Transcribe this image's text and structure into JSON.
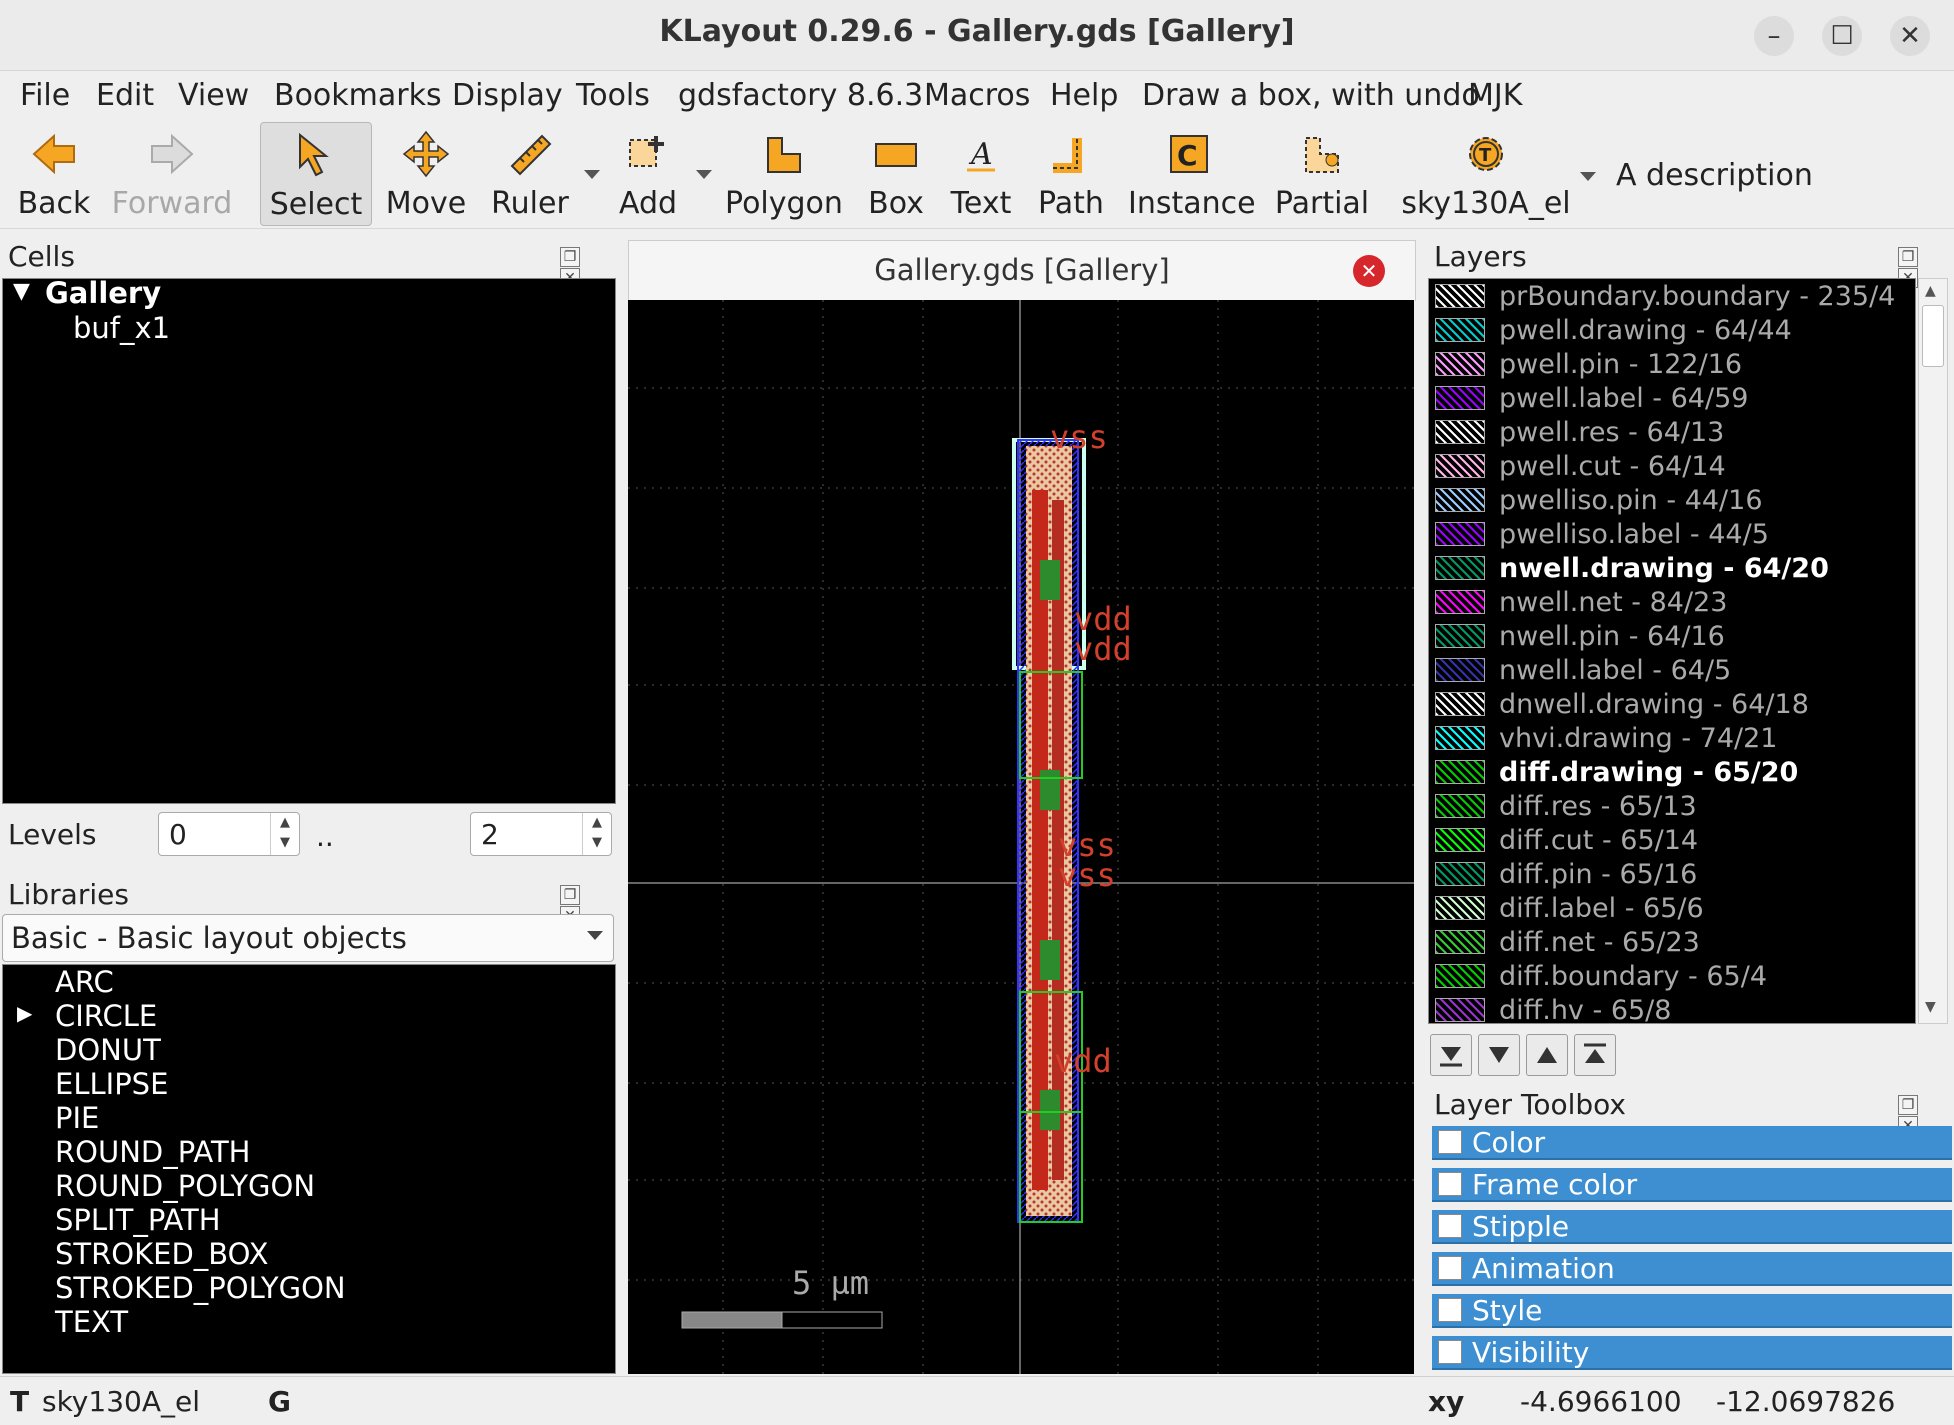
{
  "window": {
    "title": "KLayout 0.29.6 - Gallery.gds [Gallery]"
  },
  "menu": [
    "File",
    "Edit",
    "View",
    "Bookmarks",
    "Display",
    "Tools",
    "gdsfactory 8.6.3",
    "Macros",
    "Help",
    "Draw a box, with undo",
    "MJK"
  ],
  "toolbar": {
    "back": "Back",
    "forward": "Forward",
    "select": "Select",
    "move": "Move",
    "ruler": "Ruler",
    "add": "Add",
    "polygon": "Polygon",
    "box": "Box",
    "text": "Text",
    "path": "Path",
    "instance": "Instance",
    "partial": "Partial",
    "tech": "sky130A_el",
    "description": "A description"
  },
  "cells": {
    "title": "Cells",
    "items": [
      "Gallery",
      "buf_x1"
    ],
    "levels_label": "Levels",
    "level_from": "0",
    "level_sep": "..",
    "level_to": "2"
  },
  "libraries": {
    "title": "Libraries",
    "selected": "Basic - Basic layout objects",
    "items": [
      "ARC",
      "CIRCLE",
      "DONUT",
      "ELLIPSE",
      "PIE",
      "ROUND_PATH",
      "ROUND_POLYGON",
      "SPLIT_PATH",
      "STROKED_BOX",
      "STROKED_POLYGON",
      "TEXT"
    ]
  },
  "canvas": {
    "tab_title": "Gallery.gds [Gallery]",
    "scale_label": "5 µm",
    "labels": [
      "vss",
      "vdd",
      "vdd",
      "vss",
      "vss",
      "vdd"
    ]
  },
  "layers": {
    "title": "Layers",
    "items": [
      {
        "name": "prBoundary.boundary - 235/4",
        "color": "#ffffff",
        "bold": false
      },
      {
        "name": "pwell.drawing - 64/44",
        "color": "#00cccc",
        "bold": false
      },
      {
        "name": "pwell.pin - 122/16",
        "color": "#ff99ff",
        "bold": false
      },
      {
        "name": "pwell.label - 64/59",
        "color": "#9900ff",
        "bold": false
      },
      {
        "name": "pwell.res - 64/13",
        "color": "#ffffff",
        "bold": false
      },
      {
        "name": "pwell.cut - 64/14",
        "color": "#ffb3e6",
        "bold": false
      },
      {
        "name": "pwelliso.pin - 44/16",
        "color": "#99ccff",
        "bold": false
      },
      {
        "name": "pwelliso.label - 44/5",
        "color": "#9900ff",
        "bold": false
      },
      {
        "name": "nwell.drawing - 64/20",
        "color": "#009966",
        "bold": true
      },
      {
        "name": "nwell.net - 84/23",
        "color": "#ff00ff",
        "bold": false
      },
      {
        "name": "nwell.pin - 64/16",
        "color": "#009966",
        "bold": false
      },
      {
        "name": "nwell.label - 64/5",
        "color": "#3333aa",
        "bold": false
      },
      {
        "name": "dnwell.drawing - 64/18",
        "color": "#ffffff",
        "bold": false
      },
      {
        "name": "vhvi.drawing - 74/21",
        "color": "#00ffff",
        "bold": false
      },
      {
        "name": "diff.drawing - 65/20",
        "color": "#00cc00",
        "bold": true
      },
      {
        "name": "diff.res - 65/13",
        "color": "#00cc00",
        "bold": false
      },
      {
        "name": "diff.cut - 65/14",
        "color": "#00ff00",
        "bold": false
      },
      {
        "name": "diff.pin - 65/16",
        "color": "#009966",
        "bold": false
      },
      {
        "name": "diff.label - 65/6",
        "color": "#ccffcc",
        "bold": false
      },
      {
        "name": "diff.net - 65/23",
        "color": "#33cc33",
        "bold": false
      },
      {
        "name": "diff.boundary - 65/4",
        "color": "#00cc00",
        "bold": false
      },
      {
        "name": "diff.hv - 65/8",
        "color": "#9933cc",
        "bold": false
      }
    ]
  },
  "layer_toolbox": {
    "title": "Layer Toolbox",
    "items": [
      "Color",
      "Frame color",
      "Stipple",
      "Animation",
      "Style",
      "Visibility"
    ]
  },
  "status": {
    "mode_label": "T",
    "tech": "sky130A_el",
    "grid_label": "G",
    "xy_label": "xy",
    "x": "-4.6966100",
    "y": "-12.0697826"
  }
}
